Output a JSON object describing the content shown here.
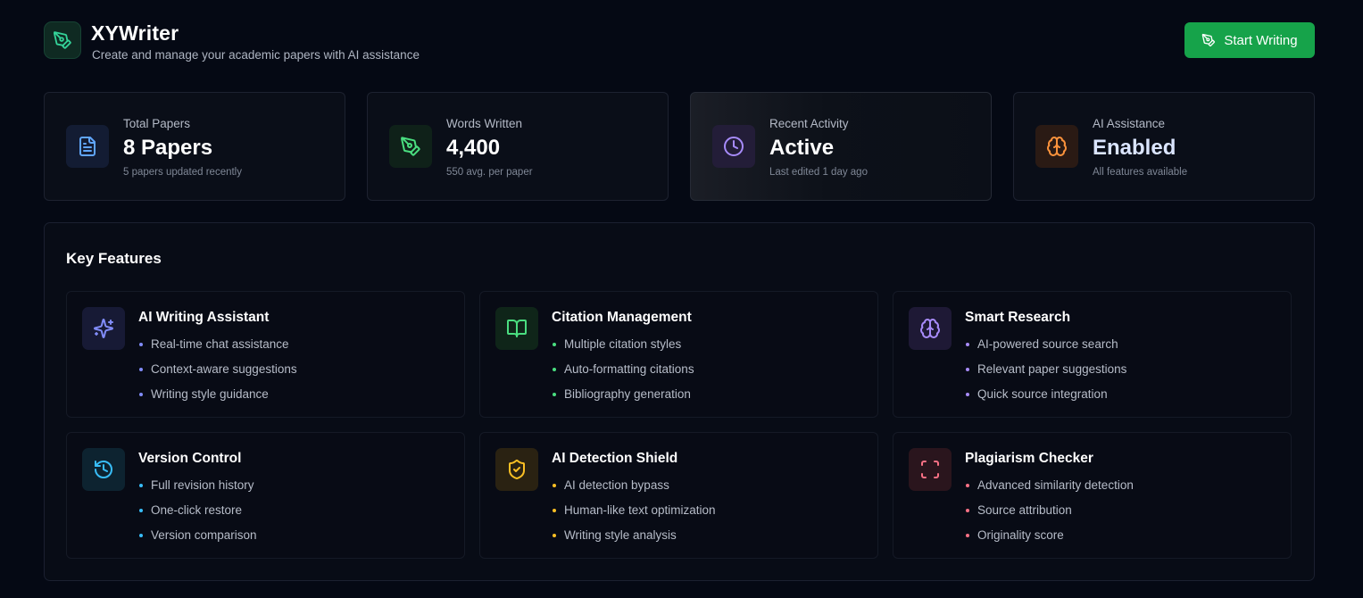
{
  "app": {
    "title": "XYWriter",
    "subtitle": "Create and manage your academic papers with AI assistance",
    "logo_icon": "pen-tool-icon",
    "start_button_label": "Start Writing"
  },
  "stats": [
    {
      "label": "Total Papers",
      "value": "8 Papers",
      "sub": "5 papers updated recently",
      "icon": "document-icon",
      "color": "#60a5fa"
    },
    {
      "label": "Words Written",
      "value": "4,400",
      "sub": "550 avg. per paper",
      "icon": "pen-tool-icon",
      "color": "#4ade80"
    },
    {
      "label": "Recent Activity",
      "value": "Active",
      "sub": "Last edited 1 day ago",
      "icon": "clock-icon",
      "color": "#a78bfa"
    },
    {
      "label": "AI Assistance",
      "value": "Enabled",
      "sub": "All features available",
      "icon": "brain-icon",
      "color": "#fb923c",
      "value_color": "#dbe5ff"
    }
  ],
  "features": {
    "title": "Key Features",
    "cards": [
      {
        "title": "AI Writing Assistant",
        "icon": "sparkles-icon",
        "color": "#818cf8",
        "items": [
          "Real-time chat assistance",
          "Context-aware suggestions",
          "Writing style guidance"
        ]
      },
      {
        "title": "Citation Management",
        "icon": "book-open-icon",
        "color": "#4ade80",
        "items": [
          "Multiple citation styles",
          "Auto-formatting citations",
          "Bibliography generation"
        ]
      },
      {
        "title": "Smart Research",
        "icon": "brain-icon",
        "color": "#a78bfa",
        "items": [
          "AI-powered source search",
          "Relevant paper suggestions",
          "Quick source integration"
        ]
      },
      {
        "title": "Version Control",
        "icon": "history-icon",
        "color": "#38bdf8",
        "items": [
          "Full revision history",
          "One-click restore",
          "Version comparison"
        ]
      },
      {
        "title": "AI Detection Shield",
        "icon": "shield-check-icon",
        "color": "#fbbf24",
        "items": [
          "AI detection bypass",
          "Human-like text optimization",
          "Writing style analysis"
        ]
      },
      {
        "title": "Plagiarism Checker",
        "icon": "scan-icon",
        "color": "#fb7185",
        "items": [
          "Advanced similarity detection",
          "Source attribution",
          "Originality score"
        ]
      }
    ]
  }
}
